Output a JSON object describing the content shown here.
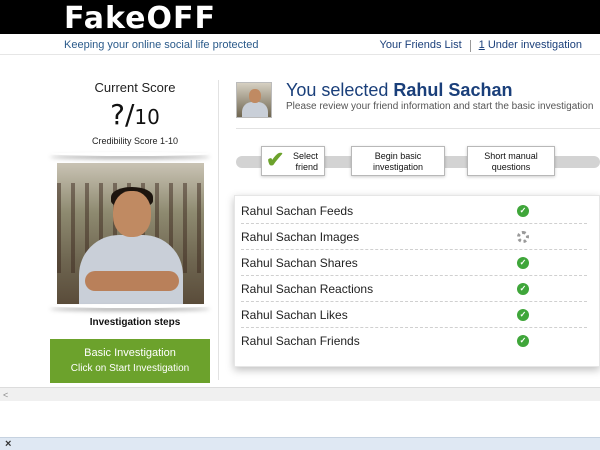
{
  "app": {
    "logo": "FakeOFF",
    "tagline": "Keeping your online social life protected"
  },
  "topnav": {
    "friends_list": "Your Friends List",
    "under_investigation_count": "1",
    "under_investigation_label": " Under investigation"
  },
  "score": {
    "title": "Current Score",
    "value": "?",
    "slash": "/",
    "max": "10",
    "subtitle": "Credibility Score 1-10"
  },
  "investigation": {
    "steps_title": "Investigation steps",
    "basic_title": "Basic Investigation",
    "basic_sub": "Click on Start Investigation",
    "basic_color": "#6ca22c"
  },
  "selection": {
    "prefix": "You selected ",
    "name": "Rahul Sachan",
    "subtitle": "Please review your friend information and start the basic investigation"
  },
  "steps": [
    {
      "line1": "Select",
      "line2": "friend",
      "done": true
    },
    {
      "line1": "Begin basic",
      "line2": "investigation",
      "done": false
    },
    {
      "line1": "Short manual",
      "line2": "questions",
      "done": false
    }
  ],
  "checks": [
    {
      "label": "Rahul Sachan Feeds",
      "status": "done"
    },
    {
      "label": "Rahul Sachan Images",
      "status": "loading"
    },
    {
      "label": "Rahul Sachan Shares",
      "status": "done"
    },
    {
      "label": "Rahul Sachan Reactions",
      "status": "done"
    },
    {
      "label": "Rahul Sachan Likes",
      "status": "done"
    },
    {
      "label": "Rahul Sachan Friends",
      "status": "done"
    }
  ],
  "icons": {
    "check_icon": "check-icon",
    "spinner_icon": "loading-spinner-icon",
    "close_icon": "close-icon",
    "scroll_left_icon": "scroll-left-arrow-icon"
  },
  "glyphs": {
    "tick": "✔",
    "small_tick": "✓",
    "close": "×",
    "left_arrow": "<"
  }
}
